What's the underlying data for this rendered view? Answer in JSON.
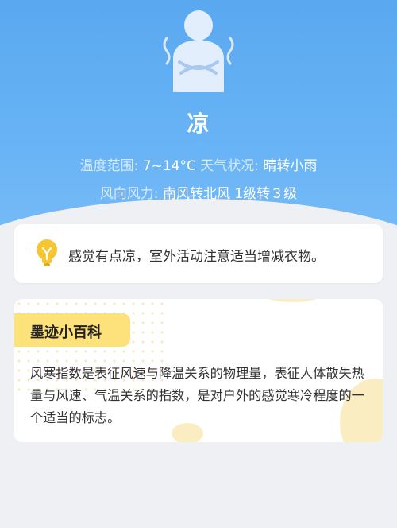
{
  "hero": {
    "icon": "cold-person-icon",
    "title": "凉",
    "temp_label": "温度范围:",
    "temp_value": "7~14°C",
    "weather_label": "天气状况:",
    "weather_value": "晴转小雨",
    "wind_label": "风向风力:",
    "wind_value": "南风转北风 1级转３级",
    "colors": {
      "hero_top": "#5aa8f0",
      "hero_bottom": "#78bcf6"
    }
  },
  "tip": {
    "icon": "lightbulb-icon",
    "text": "感觉有点凉，室外活动注意适当增减衣物。",
    "icon_color": "#f7c531"
  },
  "encyclopedia": {
    "title": "墨迹小百科",
    "body": "风寒指数是表征风速与降温关系的物理量，表征人体散失热量与风速、气温关系的指数，是对户外的感觉寒冷程度的一个适当的标志。",
    "badge_color": "#fde17a"
  }
}
